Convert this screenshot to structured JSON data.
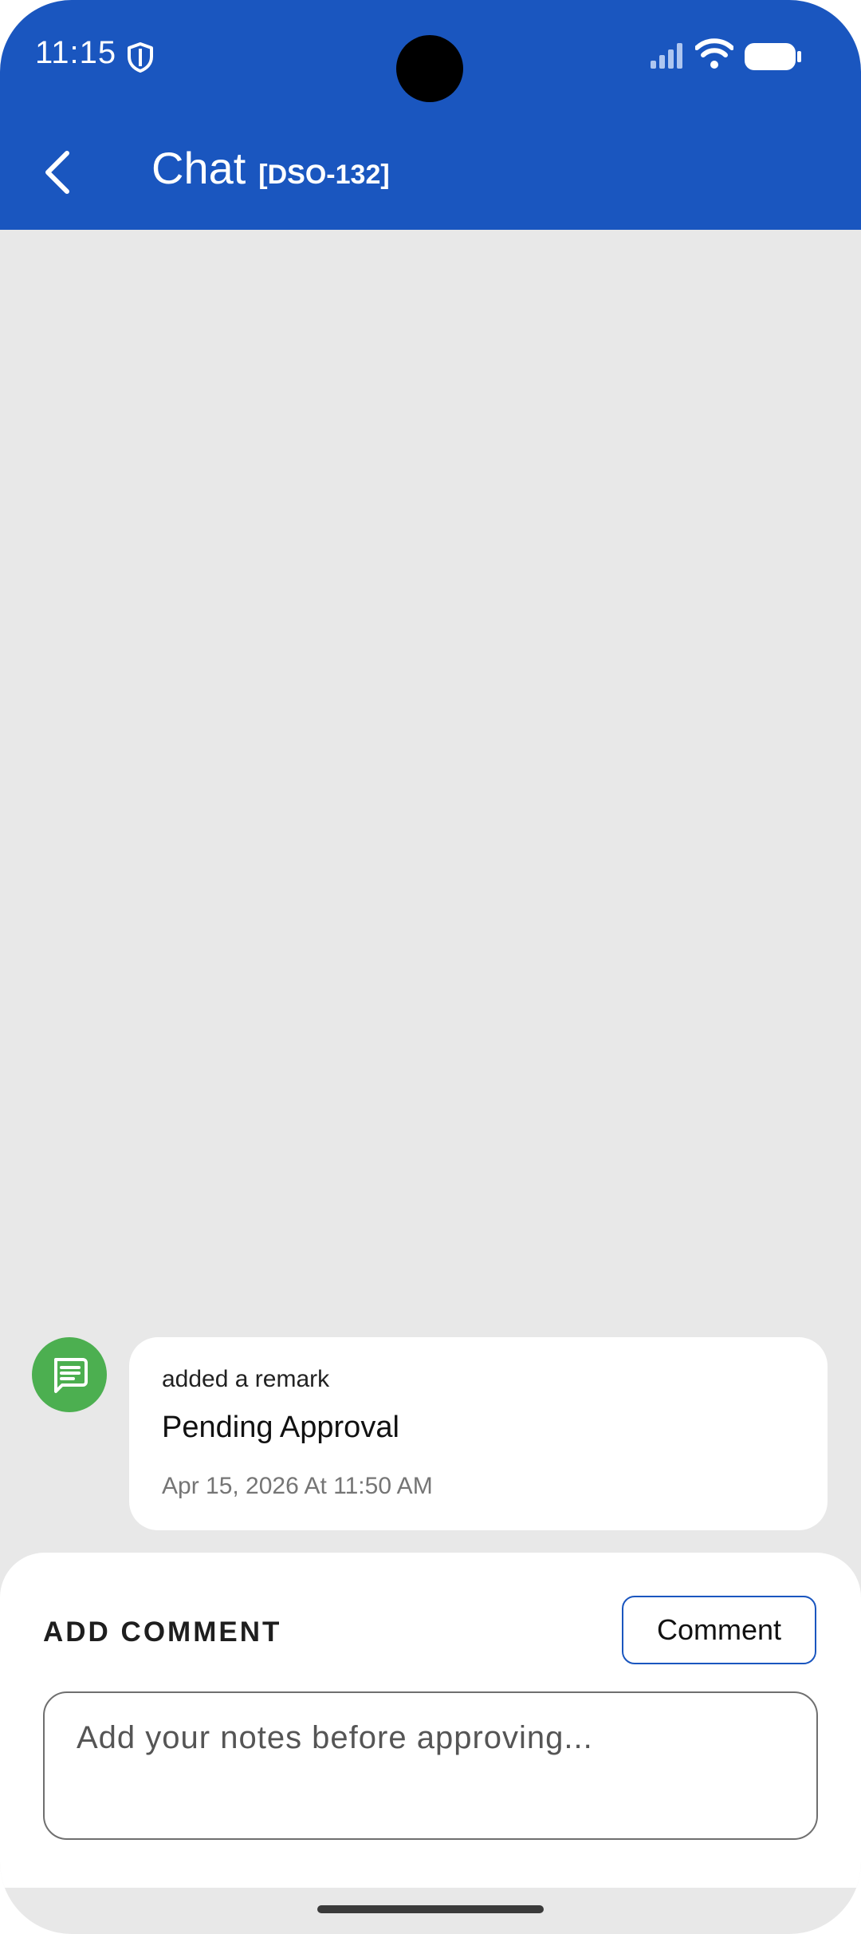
{
  "status_bar": {
    "time": "11:15"
  },
  "header": {
    "title": "Chat",
    "ticket_id": "[DSO-132]"
  },
  "chat": {
    "messages": [
      {
        "action": "added a remark",
        "message": "Pending Approval",
        "timestamp": "Apr 15, 2026 At 11:50 AM",
        "avatar_icon": "message-icon"
      }
    ]
  },
  "comment_panel": {
    "heading": "ADD COMMENT",
    "button_label": "Comment",
    "input_placeholder": "Add your notes before approving...",
    "input_value": ""
  },
  "colors": {
    "app_bar": "#1a56bf",
    "background": "#e8e8e8",
    "avatar": "#4caf50"
  }
}
